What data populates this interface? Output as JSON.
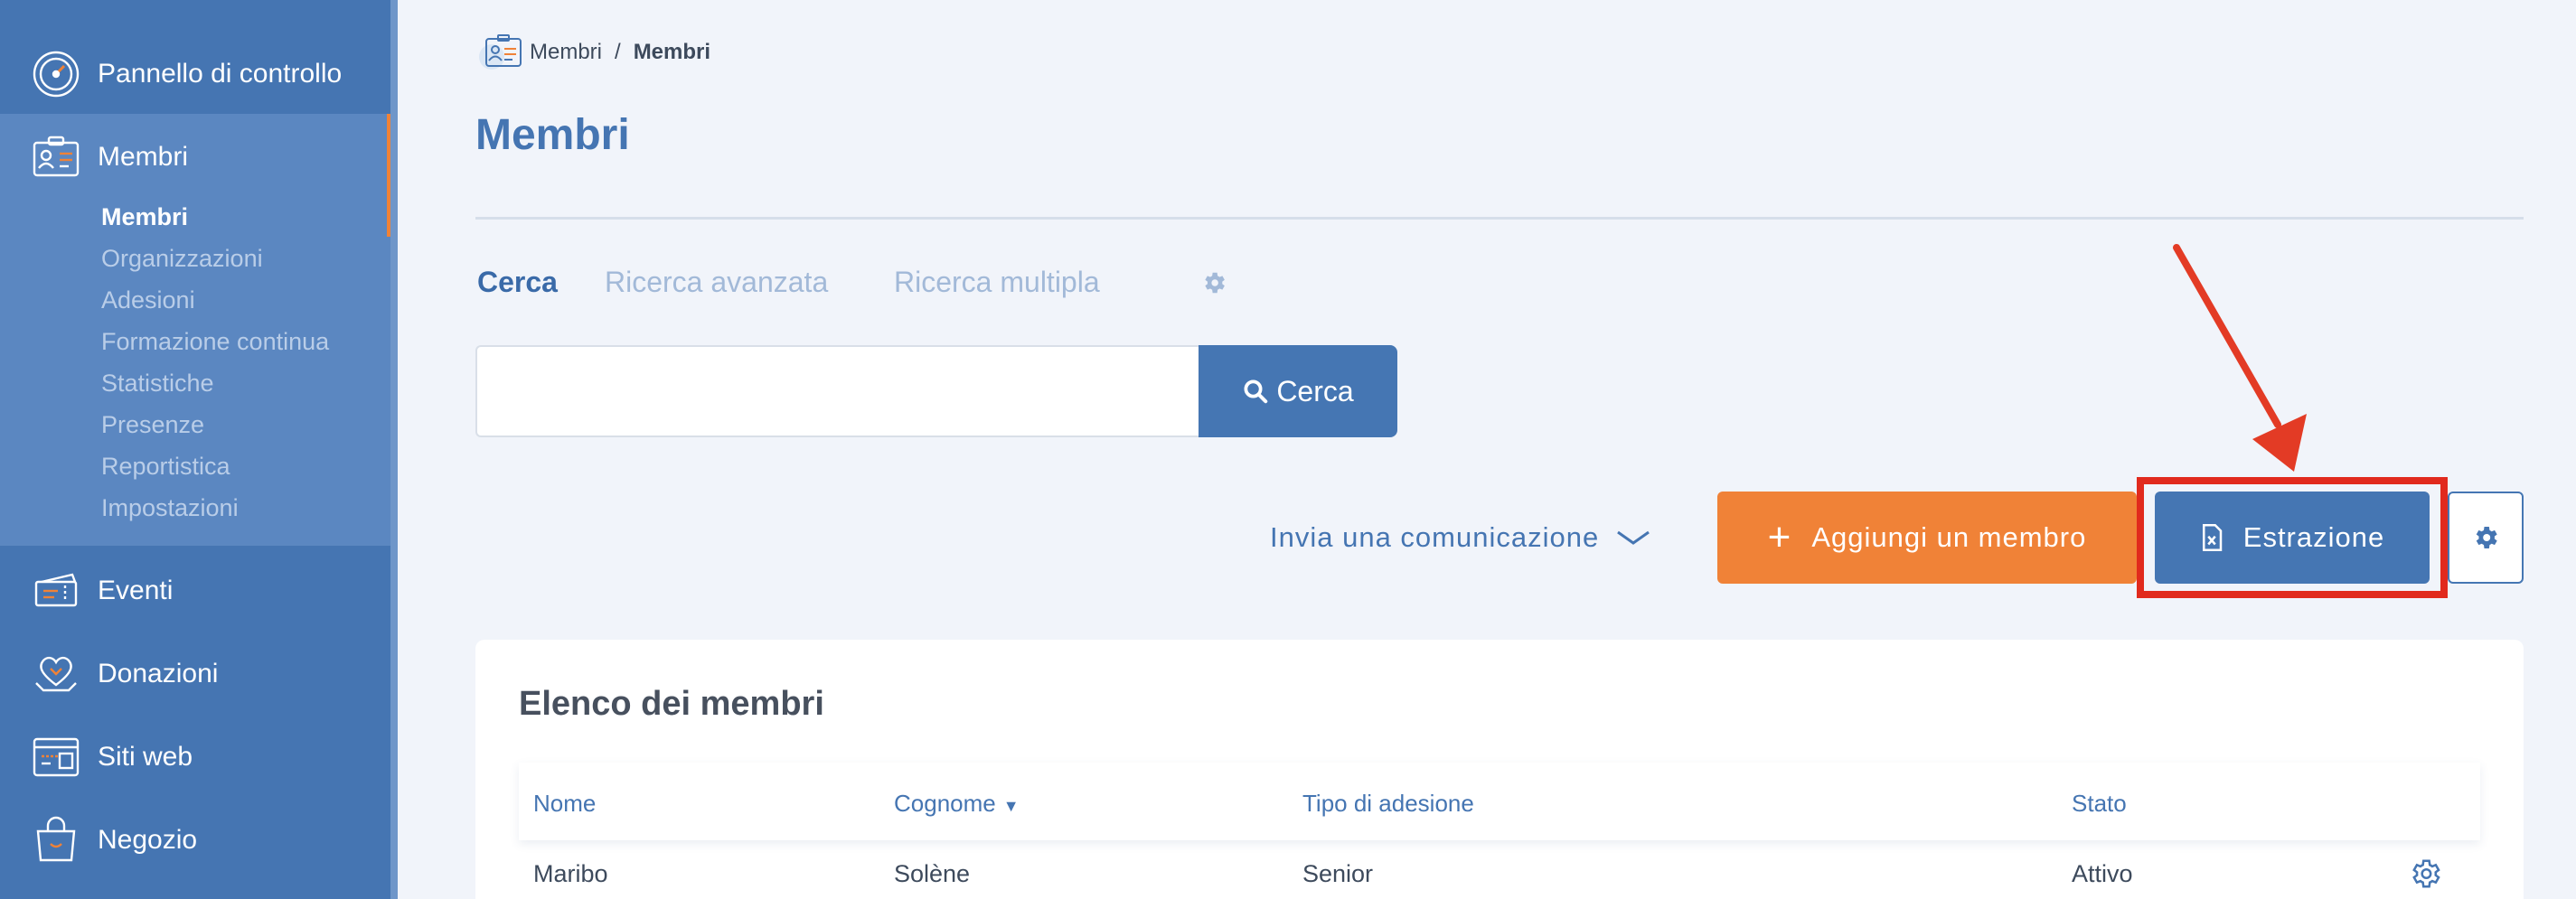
{
  "sidebar": {
    "items": [
      {
        "label": "Pannello di controllo",
        "icon": "dashboard-gauge-icon"
      },
      {
        "label": "Membri",
        "icon": "member-card-icon"
      },
      {
        "label": "Eventi",
        "icon": "event-tickets-icon"
      },
      {
        "label": "Donazioni",
        "icon": "donation-heart-icon"
      },
      {
        "label": "Siti web",
        "icon": "website-icon"
      },
      {
        "label": "Negozio",
        "icon": "shopping-bag-icon"
      }
    ],
    "submenu": [
      {
        "label": "Membri",
        "active": true
      },
      {
        "label": "Organizzazioni"
      },
      {
        "label": "Adesioni"
      },
      {
        "label": "Formazione continua"
      },
      {
        "label": "Statistiche"
      },
      {
        "label": "Presenze"
      },
      {
        "label": "Reportistica"
      },
      {
        "label": "Impostazioni"
      }
    ]
  },
  "breadcrumb": {
    "parent": "Membri",
    "separator": "/",
    "current": "Membri"
  },
  "page": {
    "title": "Membri"
  },
  "tabs": [
    {
      "label": "Cerca",
      "active": true
    },
    {
      "label": "Ricerca avanzata"
    },
    {
      "label": "Ricerca multipla"
    }
  ],
  "search": {
    "value": "",
    "placeholder": "",
    "button_label": "Cerca"
  },
  "actions": {
    "communication_label": "Invia una comunicazione",
    "add_member_label": "Aggiungi un membro",
    "export_label": "Estrazione"
  },
  "list": {
    "title": "Elenco dei membri",
    "columns": [
      "Nome",
      "Cognome",
      "Tipo di adesione",
      "Stato"
    ],
    "sorted_column": "Cognome",
    "rows": [
      {
        "nome": "Maribo",
        "cognome": "Solène",
        "tipo": "Senior",
        "stato": "Attivo"
      }
    ]
  },
  "colors": {
    "sidebar": "#4575b2",
    "primary": "#4576b3",
    "accent": "#f08237",
    "highlight": "#e12a1d"
  }
}
